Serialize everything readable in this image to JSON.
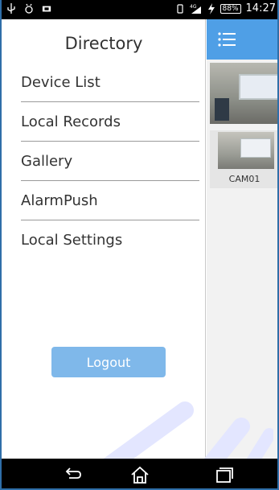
{
  "status_bar": {
    "network_label": "4G",
    "battery": "88%",
    "time": "14:27"
  },
  "drawer": {
    "title": "Directory",
    "items": [
      {
        "label": "Device List"
      },
      {
        "label": "Local Records"
      },
      {
        "label": "Gallery"
      },
      {
        "label": "AlarmPush"
      },
      {
        "label": "Local Settings"
      }
    ],
    "logout_label": "Logout"
  },
  "main": {
    "camera_label": "CAM01"
  },
  "colors": {
    "header_blue": "#4f9fe6",
    "logout_button": "#7fb8ea"
  },
  "icons": [
    "usb-icon",
    "mute-icon",
    "notification-icon",
    "vibrate-icon",
    "signal-icon",
    "charging-icon",
    "hamburger-menu-icon",
    "back-icon",
    "home-icon",
    "recent-apps-icon"
  ]
}
